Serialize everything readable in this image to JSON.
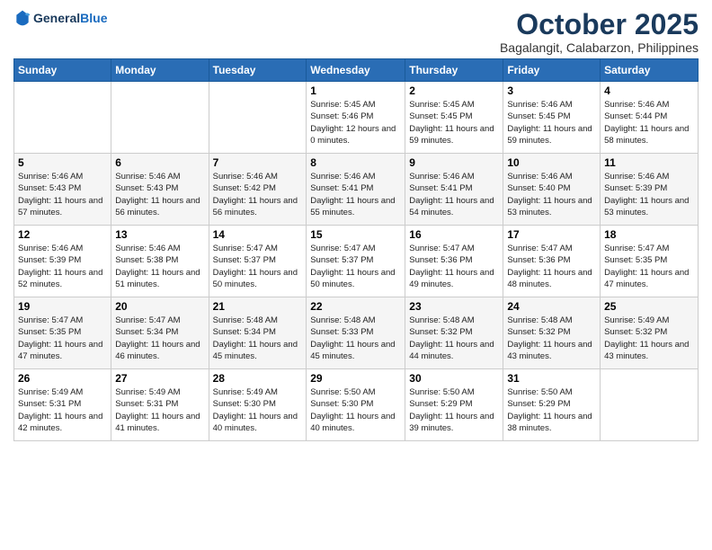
{
  "header": {
    "logo_line1": "General",
    "logo_line2": "Blue",
    "month": "October 2025",
    "location": "Bagalangit, Calabarzon, Philippines"
  },
  "weekdays": [
    "Sunday",
    "Monday",
    "Tuesday",
    "Wednesday",
    "Thursday",
    "Friday",
    "Saturday"
  ],
  "weeks": [
    [
      {
        "day": "",
        "info": ""
      },
      {
        "day": "",
        "info": ""
      },
      {
        "day": "",
        "info": ""
      },
      {
        "day": "1",
        "info": "Sunrise: 5:45 AM\nSunset: 5:46 PM\nDaylight: 12 hours\nand 0 minutes."
      },
      {
        "day": "2",
        "info": "Sunrise: 5:45 AM\nSunset: 5:45 PM\nDaylight: 11 hours\nand 59 minutes."
      },
      {
        "day": "3",
        "info": "Sunrise: 5:46 AM\nSunset: 5:45 PM\nDaylight: 11 hours\nand 59 minutes."
      },
      {
        "day": "4",
        "info": "Sunrise: 5:46 AM\nSunset: 5:44 PM\nDaylight: 11 hours\nand 58 minutes."
      }
    ],
    [
      {
        "day": "5",
        "info": "Sunrise: 5:46 AM\nSunset: 5:43 PM\nDaylight: 11 hours\nand 57 minutes."
      },
      {
        "day": "6",
        "info": "Sunrise: 5:46 AM\nSunset: 5:43 PM\nDaylight: 11 hours\nand 56 minutes."
      },
      {
        "day": "7",
        "info": "Sunrise: 5:46 AM\nSunset: 5:42 PM\nDaylight: 11 hours\nand 56 minutes."
      },
      {
        "day": "8",
        "info": "Sunrise: 5:46 AM\nSunset: 5:41 PM\nDaylight: 11 hours\nand 55 minutes."
      },
      {
        "day": "9",
        "info": "Sunrise: 5:46 AM\nSunset: 5:41 PM\nDaylight: 11 hours\nand 54 minutes."
      },
      {
        "day": "10",
        "info": "Sunrise: 5:46 AM\nSunset: 5:40 PM\nDaylight: 11 hours\nand 53 minutes."
      },
      {
        "day": "11",
        "info": "Sunrise: 5:46 AM\nSunset: 5:39 PM\nDaylight: 11 hours\nand 53 minutes."
      }
    ],
    [
      {
        "day": "12",
        "info": "Sunrise: 5:46 AM\nSunset: 5:39 PM\nDaylight: 11 hours\nand 52 minutes."
      },
      {
        "day": "13",
        "info": "Sunrise: 5:46 AM\nSunset: 5:38 PM\nDaylight: 11 hours\nand 51 minutes."
      },
      {
        "day": "14",
        "info": "Sunrise: 5:47 AM\nSunset: 5:37 PM\nDaylight: 11 hours\nand 50 minutes."
      },
      {
        "day": "15",
        "info": "Sunrise: 5:47 AM\nSunset: 5:37 PM\nDaylight: 11 hours\nand 50 minutes."
      },
      {
        "day": "16",
        "info": "Sunrise: 5:47 AM\nSunset: 5:36 PM\nDaylight: 11 hours\nand 49 minutes."
      },
      {
        "day": "17",
        "info": "Sunrise: 5:47 AM\nSunset: 5:36 PM\nDaylight: 11 hours\nand 48 minutes."
      },
      {
        "day": "18",
        "info": "Sunrise: 5:47 AM\nSunset: 5:35 PM\nDaylight: 11 hours\nand 47 minutes."
      }
    ],
    [
      {
        "day": "19",
        "info": "Sunrise: 5:47 AM\nSunset: 5:35 PM\nDaylight: 11 hours\nand 47 minutes."
      },
      {
        "day": "20",
        "info": "Sunrise: 5:47 AM\nSunset: 5:34 PM\nDaylight: 11 hours\nand 46 minutes."
      },
      {
        "day": "21",
        "info": "Sunrise: 5:48 AM\nSunset: 5:34 PM\nDaylight: 11 hours\nand 45 minutes."
      },
      {
        "day": "22",
        "info": "Sunrise: 5:48 AM\nSunset: 5:33 PM\nDaylight: 11 hours\nand 45 minutes."
      },
      {
        "day": "23",
        "info": "Sunrise: 5:48 AM\nSunset: 5:32 PM\nDaylight: 11 hours\nand 44 minutes."
      },
      {
        "day": "24",
        "info": "Sunrise: 5:48 AM\nSunset: 5:32 PM\nDaylight: 11 hours\nand 43 minutes."
      },
      {
        "day": "25",
        "info": "Sunrise: 5:49 AM\nSunset: 5:32 PM\nDaylight: 11 hours\nand 43 minutes."
      }
    ],
    [
      {
        "day": "26",
        "info": "Sunrise: 5:49 AM\nSunset: 5:31 PM\nDaylight: 11 hours\nand 42 minutes."
      },
      {
        "day": "27",
        "info": "Sunrise: 5:49 AM\nSunset: 5:31 PM\nDaylight: 11 hours\nand 41 minutes."
      },
      {
        "day": "28",
        "info": "Sunrise: 5:49 AM\nSunset: 5:30 PM\nDaylight: 11 hours\nand 40 minutes."
      },
      {
        "day": "29",
        "info": "Sunrise: 5:50 AM\nSunset: 5:30 PM\nDaylight: 11 hours\nand 40 minutes."
      },
      {
        "day": "30",
        "info": "Sunrise: 5:50 AM\nSunset: 5:29 PM\nDaylight: 11 hours\nand 39 minutes."
      },
      {
        "day": "31",
        "info": "Sunrise: 5:50 AM\nSunset: 5:29 PM\nDaylight: 11 hours\nand 38 minutes."
      },
      {
        "day": "",
        "info": ""
      }
    ]
  ]
}
